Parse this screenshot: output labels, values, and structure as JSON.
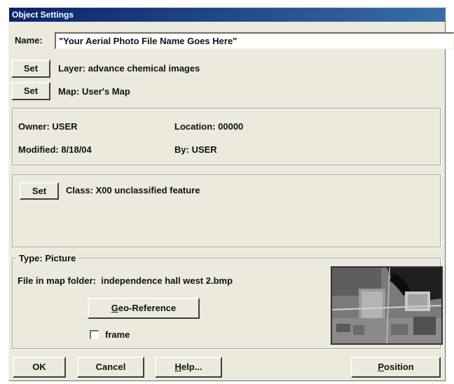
{
  "window": {
    "title": "Object Settings"
  },
  "name": {
    "label": "Name:",
    "value": "\"Your Aerial Photo File Name Goes Here\""
  },
  "layer": {
    "set_label": "Set",
    "text": "Layer: advance chemical images"
  },
  "map": {
    "set_label": "Set",
    "text": "Map: User's Map"
  },
  "info": {
    "owner_label": "Owner:",
    "owner": "USER",
    "location_label": "Location:",
    "location": "00000",
    "modified_label": "Modified:",
    "modified": "8/18/04",
    "by_label": "By:",
    "by": "USER"
  },
  "class": {
    "set_label": "Set",
    "text": "Class:  X00 unclassified feature"
  },
  "type": {
    "label": "Type: Picture",
    "file_label": "File in map folder:",
    "file_name": "independence hall west 2.bmp",
    "georef_label": "Geo-Reference",
    "frame_label": "frame",
    "frame_checked": false,
    "thumbnail_icon": "aerial-photo-thumbnail"
  },
  "buttons": {
    "ok": "OK",
    "cancel": "Cancel",
    "help": "Help...",
    "position": "Position"
  }
}
